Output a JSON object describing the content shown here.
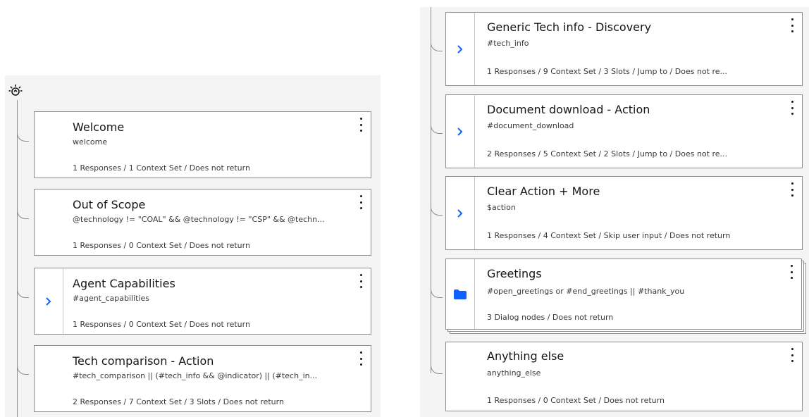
{
  "left_tree": {
    "nodes": [
      {
        "title": "Welcome",
        "condition": "welcome",
        "meta": "1 Responses / 1 Context Set / Does not return"
      },
      {
        "title": "Out of Scope",
        "condition": "@technology != \"COAL\" && @technology != \"CSP\" && @techn...",
        "meta": "1 Responses / 0 Context Set / Does not return"
      },
      {
        "title": "Agent Capabilities",
        "condition": "#agent_capabilities",
        "meta": "1 Responses / 0 Context Set / Does not return"
      },
      {
        "title": "Tech comparison - Action",
        "condition": "#tech_comparison || (#tech_info && @indicator) || (#tech_in...",
        "meta": "2 Responses / 7 Context Set / 3 Slots / Does not return"
      }
    ]
  },
  "right_tree": {
    "nodes": [
      {
        "title": "Generic Tech info - Discovery",
        "condition": "#tech_info",
        "meta": "1 Responses / 9 Context Set / 3 Slots / Jump to / Does not re..."
      },
      {
        "title": "Document download - Action",
        "condition": "#document_download",
        "meta": "2 Responses / 5 Context Set / 2 Slots / Jump to / Does not re..."
      },
      {
        "title": "Clear Action + More",
        "condition": "$action",
        "meta": "1 Responses / 4 Context Set / Skip user input / Does not return"
      },
      {
        "title": "Greetings",
        "condition": "#open_greetings or #end_greetings || #thank_you",
        "meta": "3 Dialog nodes / Does not return"
      },
      {
        "title": "Anything else",
        "condition": "anything_else",
        "meta": "1 Responses / 0 Context Set / Does not return"
      }
    ]
  },
  "icons": {
    "root": "lightbulb-icon",
    "expand": "chevron-right-icon",
    "folder": "folder-icon",
    "menu": "overflow-menu-icon"
  },
  "colors": {
    "accent": "#0f62fe",
    "panel_bg": "#f4f4f4",
    "border": "#8d8d8d"
  }
}
